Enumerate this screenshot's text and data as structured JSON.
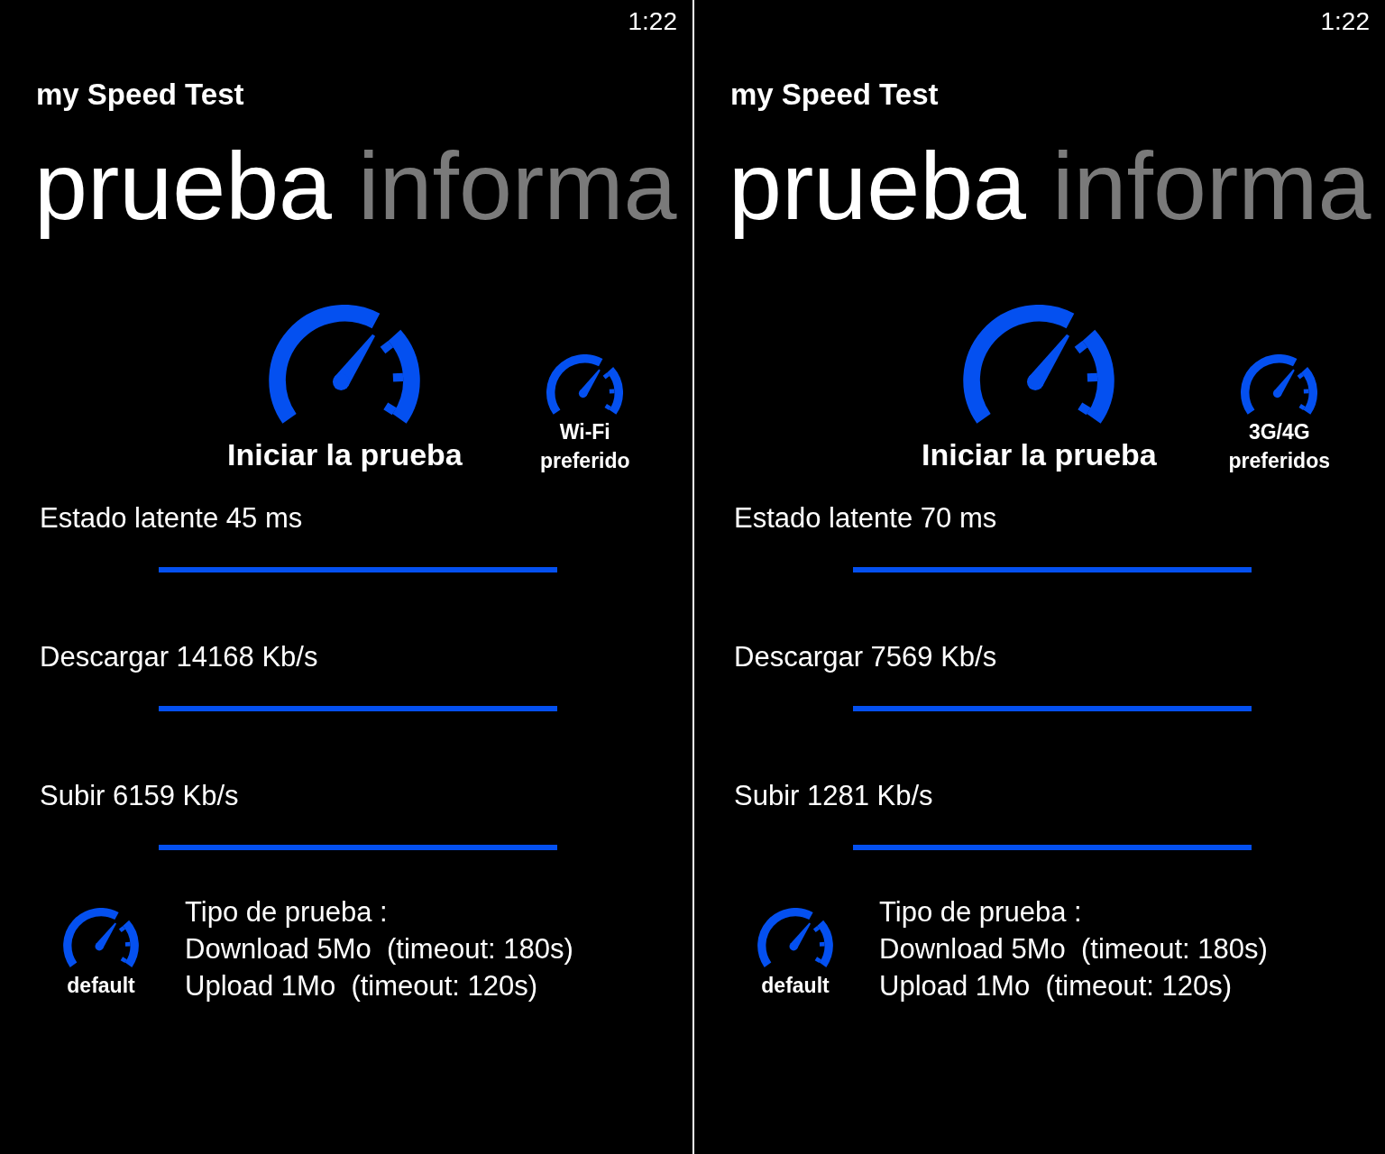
{
  "screens": [
    {
      "status_bar": {
        "time": "1:22"
      },
      "app_title": "my Speed Test",
      "pivot": [
        {
          "label": "prueba",
          "selected": true
        },
        {
          "label": "informa",
          "selected": false
        }
      ],
      "start_button": {
        "label": "Iniciar la prueba"
      },
      "network_button": {
        "label": "Wi-Fi preferido"
      },
      "results": [
        {
          "label": "Estado latente 45 ms",
          "level": 1
        },
        {
          "label": "Descargar 14168 Kb/s",
          "level": 1
        },
        {
          "label": "Subir 6159 Kb/s",
          "level": 1
        }
      ],
      "test_profile": {
        "button_label": "default",
        "lines": [
          "Tipo de prueba :",
          "Download 5Mo  (timeout: 180s)",
          "Upload 1Mo  (timeout: 120s)"
        ]
      }
    },
    {
      "status_bar": {
        "time": "1:22"
      },
      "app_title": "my Speed Test",
      "pivot": [
        {
          "label": "prueba",
          "selected": true
        },
        {
          "label": "informa",
          "selected": false
        }
      ],
      "start_button": {
        "label": "Iniciar la prueba"
      },
      "network_button": {
        "label": "3G/4G preferidos"
      },
      "results": [
        {
          "label": "Estado latente 70 ms",
          "level": 1
        },
        {
          "label": "Descargar 7569 Kb/s",
          "level": 1
        },
        {
          "label": "Subir 1281 Kb/s",
          "level": 1
        }
      ],
      "test_profile": {
        "button_label": "default",
        "lines": [
          "Tipo de prueba :",
          "Download 5Mo  (timeout: 180s)",
          "Upload 1Mo  (timeout: 120s)"
        ]
      }
    }
  ]
}
